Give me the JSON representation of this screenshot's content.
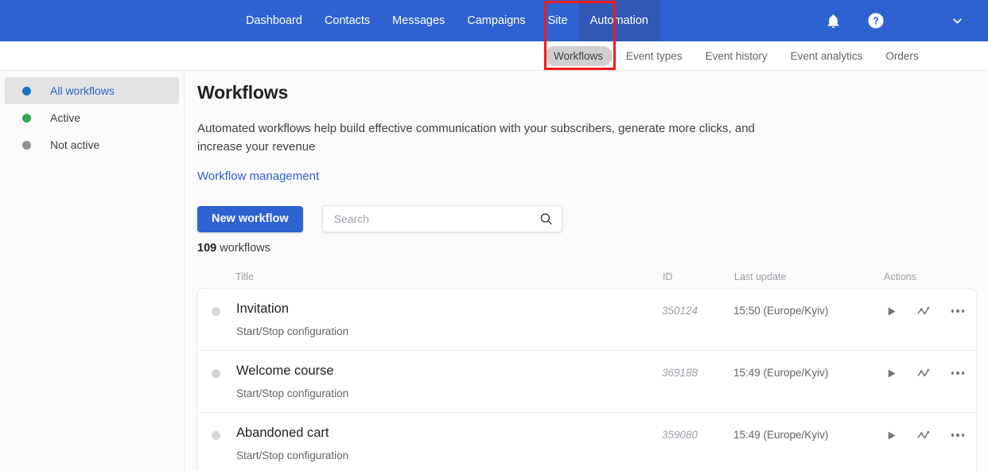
{
  "topnav": {
    "links": [
      {
        "label": "Dashboard",
        "active": false
      },
      {
        "label": "Contacts",
        "active": false
      },
      {
        "label": "Messages",
        "active": false
      },
      {
        "label": "Campaigns",
        "active": false
      },
      {
        "label": "Site",
        "active": false
      },
      {
        "label": "Automation",
        "active": true
      }
    ],
    "icons": {
      "notifications": "bell-icon",
      "help": "help-circle-icon",
      "account_menu": "chevron-down-icon"
    },
    "background_color": "#2d62d0",
    "active_tab_color": "#3059b5"
  },
  "subnav": {
    "items": [
      {
        "label": "Workflows",
        "active": true
      },
      {
        "label": "Event types",
        "active": false
      },
      {
        "label": "Event history",
        "active": false
      },
      {
        "label": "Event analytics",
        "active": false
      },
      {
        "label": "Orders",
        "active": false
      }
    ],
    "active_pill_color": "#cfcfcf"
  },
  "highlight": {
    "color": "#f01b1b",
    "target": "Automation"
  },
  "sidebar": {
    "items": [
      {
        "label": "All workflows",
        "dot_color": "#1a73c8",
        "active": true
      },
      {
        "label": "Active",
        "dot_color": "#34a853",
        "active": false
      },
      {
        "label": "Not active",
        "dot_color": "#919191",
        "active": false
      }
    ]
  },
  "main": {
    "title": "Workflows",
    "description": "Automated workflows help build effective communication with your subscribers, generate more clicks, and increase your revenue",
    "management_link": "Workflow management",
    "new_workflow_button": "New workflow",
    "search": {
      "placeholder": "Search",
      "value": "",
      "icon": "search-icon"
    },
    "count_number": "109",
    "count_label": "workflows",
    "table": {
      "headers": {
        "title": "Title",
        "id": "ID",
        "last_update": "Last update",
        "actions": "Actions"
      },
      "rows": [
        {
          "title": "Invitation",
          "subtitle": "Start/Stop configuration",
          "id": "350124",
          "last_update": "15:50 (Europe/Kyiv)",
          "status_dot_color": "#d6d6d6",
          "actions": [
            "play-icon",
            "analytics-line-icon",
            "more-options-icon"
          ]
        },
        {
          "title": "Welcome course",
          "subtitle": "Start/Stop configuration",
          "id": "369188",
          "last_update": "15:49 (Europe/Kyiv)",
          "status_dot_color": "#d6d6d6",
          "actions": [
            "play-icon",
            "analytics-line-icon",
            "more-options-icon"
          ]
        },
        {
          "title": "Abandoned cart",
          "subtitle": "Start/Stop configuration",
          "id": "359080",
          "last_update": "15:49 (Europe/Kyiv)",
          "status_dot_color": "#d6d6d6",
          "actions": [
            "play-icon",
            "analytics-line-icon",
            "more-options-icon"
          ]
        }
      ]
    }
  }
}
